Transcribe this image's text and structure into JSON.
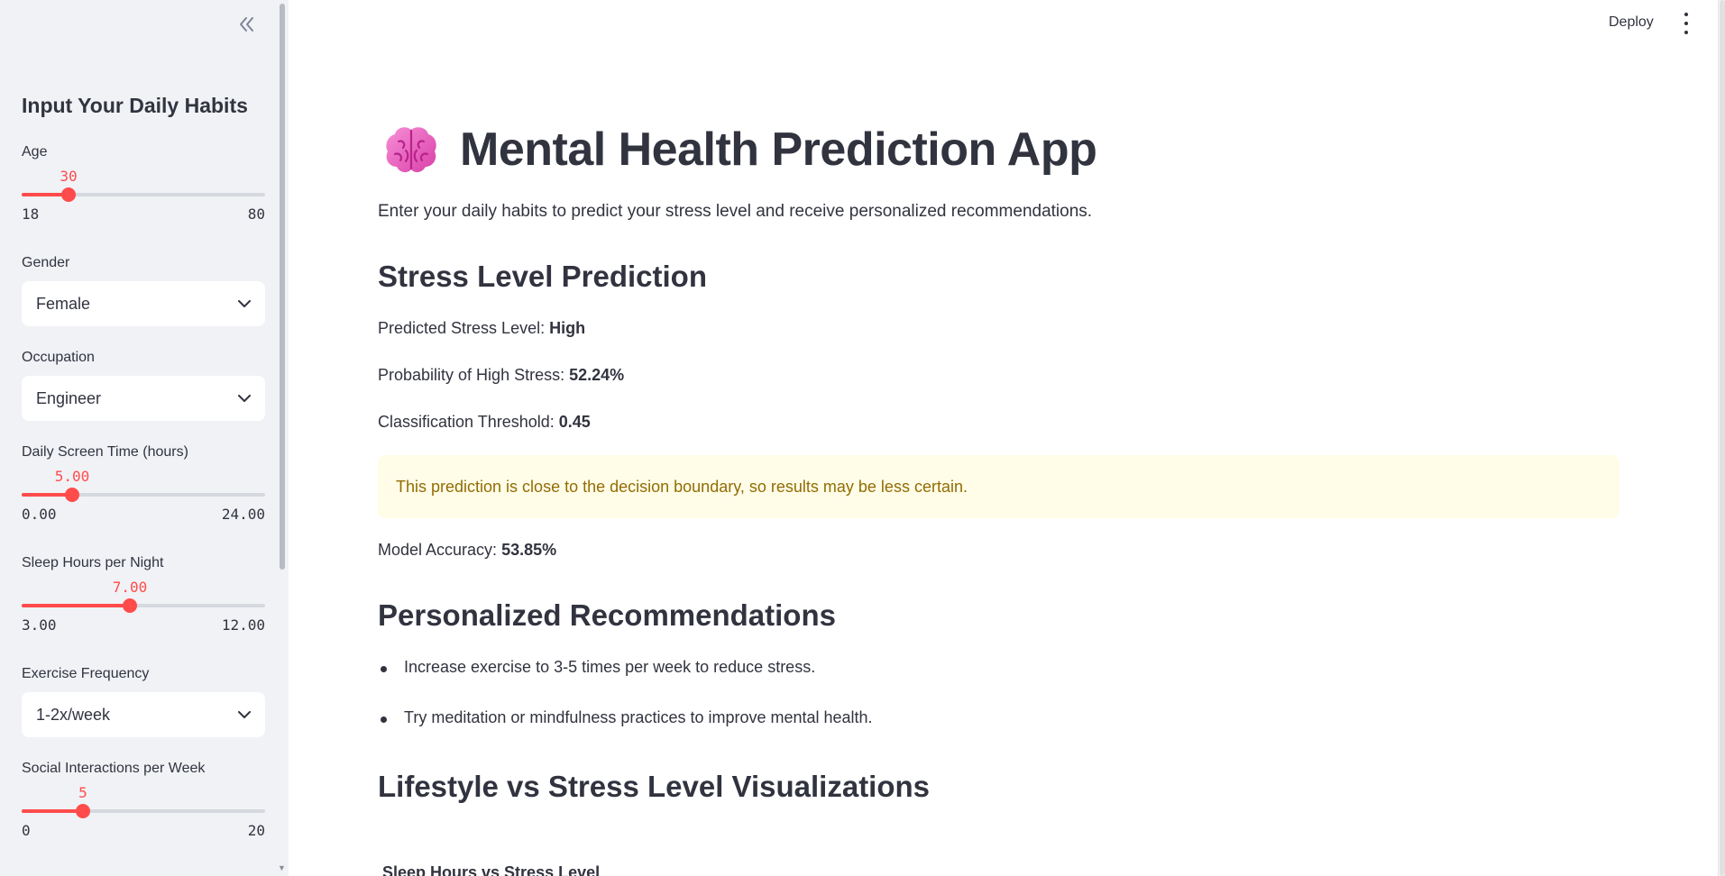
{
  "sidebar": {
    "title": "Input Your Daily Habits",
    "age": {
      "label": "Age",
      "value": "30",
      "min": "18",
      "max": "80",
      "fraction": 0.194
    },
    "gender": {
      "label": "Gender",
      "selected": "Female"
    },
    "occupation": {
      "label": "Occupation",
      "selected": "Engineer"
    },
    "screen_time": {
      "label": "Daily Screen Time (hours)",
      "value": "5.00",
      "min": "0.00",
      "max": "24.00",
      "fraction": 0.208
    },
    "sleep": {
      "label": "Sleep Hours per Night",
      "value": "7.00",
      "min": "3.00",
      "max": "12.00",
      "fraction": 0.444
    },
    "exercise": {
      "label": "Exercise Frequency",
      "selected": "1-2x/week"
    },
    "social": {
      "label": "Social Interactions per Week",
      "value": "5",
      "min": "0",
      "max": "20",
      "fraction": 0.25
    }
  },
  "header": {
    "deploy_label": "Deploy"
  },
  "main": {
    "title": "Mental Health Prediction App",
    "intro": "Enter your daily habits to predict your stress level and receive personalized recommendations.",
    "prediction_heading": "Stress Level Prediction",
    "predicted_label": "Predicted Stress Level: ",
    "predicted_value": "High",
    "probability_label": "Probability of High Stress: ",
    "probability_value": "52.24%",
    "threshold_label": "Classification Threshold: ",
    "threshold_value": "0.45",
    "warning": "This prediction is close to the decision boundary, so results may be less certain.",
    "accuracy_label": "Model Accuracy: ",
    "accuracy_value": "53.85%",
    "recommendations_heading": "Personalized Recommendations",
    "recommendations": [
      "Increase exercise to 3-5 times per week to reduce stress.",
      "Try meditation or mindfulness practices to improve mental health."
    ],
    "viz_heading": "Lifestyle vs Stress Level Visualizations",
    "viz_subheading": "Sleep Hours vs Stress Level"
  },
  "colors": {
    "accent": "#ff4b4b",
    "sidebar_bg": "#f0f2f6",
    "warning_bg": "#fffde7",
    "warning_text": "#926c05"
  },
  "icons": {
    "collapse": "double-chevron-left-icon",
    "menu": "vertical-dots-icon",
    "title": "brain-icon",
    "select": "chevron-down-icon"
  }
}
